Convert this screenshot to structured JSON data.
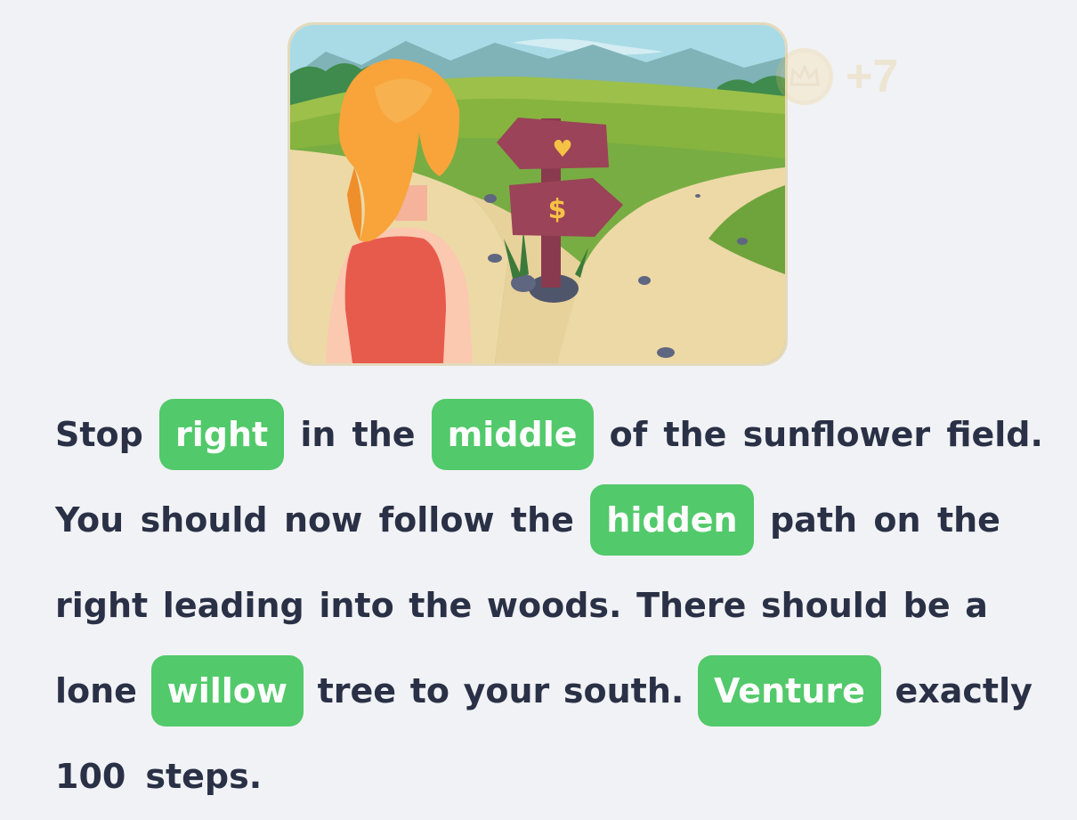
{
  "reward": {
    "points": "+7",
    "coin_icon": "crown-coin-icon"
  },
  "illustration": {
    "subject": "woman-at-crossroads-signpost",
    "sign_top_symbol": "♥",
    "sign_bottom_symbol": "$"
  },
  "passage": {
    "line1": {
      "w1": "Stop",
      "chip1": "right",
      "w2": "in",
      "w3": "the",
      "chip2": "middle",
      "w4": "of",
      "w5": "the",
      "w6": "sunflower",
      "w7": "field."
    },
    "line2": {
      "w1": "You",
      "w2": "should",
      "w3": "now",
      "w4": "follow",
      "w5": "the",
      "chip1": "hidden",
      "w6": "path",
      "w7": "on",
      "w8": "the"
    },
    "line3": {
      "w1": "right",
      "w2": "leading",
      "w3": "into",
      "w4": "the",
      "w5": "woods.",
      "w6": "There",
      "w7": "should",
      "w8": "be",
      "w9": "a"
    },
    "line4": {
      "w1": "lone",
      "chip1": "willow",
      "w2": "tree",
      "w3": "to",
      "w4": "your",
      "w5": "south.",
      "chip2": "Venture",
      "w6": "exactly"
    },
    "line5": {
      "w1": "100",
      "w2": "steps."
    }
  },
  "colors": {
    "background": "#f1f2f5",
    "chip": "#52c96a",
    "text": "#2a3146"
  }
}
